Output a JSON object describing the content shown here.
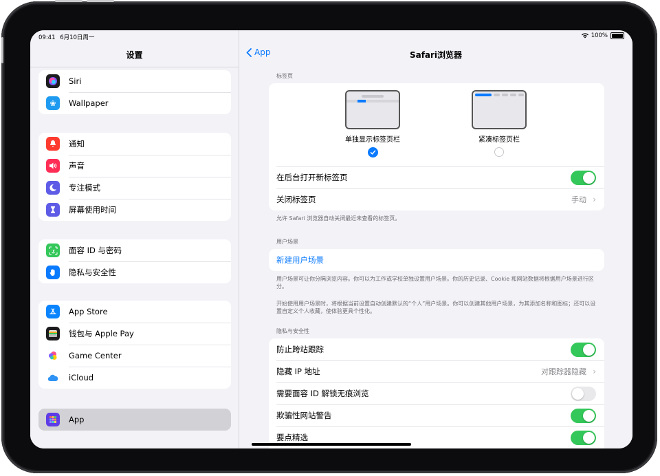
{
  "status": {
    "time": "09:41",
    "date": "6月10日周一",
    "battery": "100%"
  },
  "sidebar": {
    "title": "设置",
    "groups": [
      {
        "items": [
          {
            "label": "Siri",
            "icon": "siri-icon",
            "color": "#1c1c1e"
          },
          {
            "label": "Wallpaper",
            "icon": "wallpaper-icon",
            "color": "#1e9bf0"
          }
        ]
      },
      {
        "items": [
          {
            "label": "通知",
            "icon": "bell-icon",
            "color": "#ff3b30"
          },
          {
            "label": "声音",
            "icon": "speaker-icon",
            "color": "#ff2d55"
          },
          {
            "label": "专注模式",
            "icon": "moon-icon",
            "color": "#5e5ce6"
          },
          {
            "label": "屏幕使用时间",
            "icon": "hourglass-icon",
            "color": "#5e5ce6"
          }
        ]
      },
      {
        "items": [
          {
            "label": "面容 ID 与密码",
            "icon": "faceid-icon",
            "color": "#34c759"
          },
          {
            "label": "隐私与安全性",
            "icon": "hand-icon",
            "color": "#0a7aff"
          }
        ]
      },
      {
        "items": [
          {
            "label": "App Store",
            "icon": "appstore-icon",
            "color": "#0a84ff"
          },
          {
            "label": "钱包与 Apple Pay",
            "icon": "wallet-icon",
            "color": "#1c1c1e"
          },
          {
            "label": "Game Center",
            "icon": "gamecenter-icon",
            "color": "#ffffff"
          },
          {
            "label": "iCloud",
            "icon": "icloud-icon",
            "color": "#ffffff"
          }
        ]
      },
      {
        "items": [
          {
            "label": "App",
            "icon": "apps-grid-icon",
            "color": "#5e3ce6"
          }
        ]
      }
    ]
  },
  "main": {
    "back_label": "App",
    "title": "Safari浏览器",
    "tabs_section": {
      "header": "标签页",
      "option_separate": "单独显示标签页栏",
      "option_compact": "紧凑标签页栏",
      "selected": "separate",
      "open_background_label": "在后台打开新标签页",
      "open_background_on": true,
      "close_tabs_label": "关闭标签页",
      "close_tabs_value": "手动",
      "footnote": "允许 Safari 浏览器自动关闭最近未查看的标签页。"
    },
    "profiles_section": {
      "header": "用户场景",
      "new_profile_label": "新建用户场景",
      "footnote1": "用户场景可让你分隔浏览内容。你可以为工作或学校单独设置用户场景。你的历史记录、Cookie 和网站数据将根据用户场景进行区分。",
      "footnote2": "开始使用用户场景时，将根据当前设置自动创建默认的“个人”用户场景。你可以创建其他用户场景，为其添加名称和图标；还可以设置自定义个人收藏，使体验更具个性化。"
    },
    "privacy_section": {
      "header": "隐私与安全性",
      "prevent_tracking_label": "防止跨站跟踪",
      "prevent_tracking_on": true,
      "hide_ip_label": "隐藏 IP 地址",
      "hide_ip_value": "对跟踪器隐藏",
      "faceid_private_label": "需要面容 ID 解锁无痕浏览",
      "faceid_private_on": false,
      "fraud_warning_label": "欺骗性网站警告",
      "fraud_warning_on": true,
      "highlights_label": "要点精选",
      "highlights_on": true
    }
  }
}
